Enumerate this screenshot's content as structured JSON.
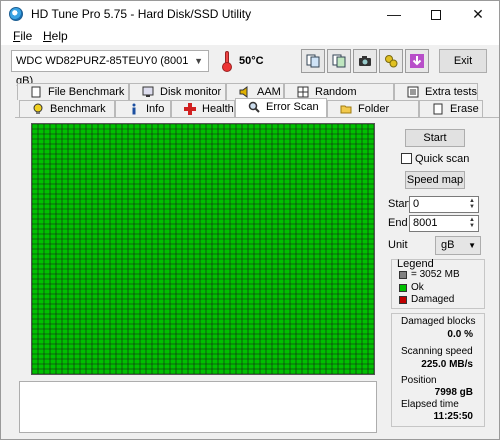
{
  "window": {
    "title": "HD Tune Pro 5.75 - Hard Disk/SSD Utility"
  },
  "menu": [
    {
      "label": "F",
      "rest": "ile"
    },
    {
      "label": "H",
      "rest": "elp"
    }
  ],
  "toolbar": {
    "drive": "WDC WD82PURZ-85TEUY0 (8001 gB)",
    "temperature": "50°C",
    "exit_label": "Exit"
  },
  "tabs": {
    "row1": [
      "File Benchmark",
      "Disk monitor",
      "AAM",
      "Random Access",
      "Extra tests"
    ],
    "row2": [
      "Benchmark",
      "Info",
      "Health",
      "Error Scan",
      "Folder Usage",
      "Erase"
    ],
    "active": "Error Scan"
  },
  "controls": {
    "start_button": "Start",
    "quick_scan_label": "Quick scan",
    "quick_scan_checked": false,
    "speed_map_button": "Speed map",
    "start_label": "Start",
    "start_value": "0",
    "end_label": "End",
    "end_value": "8001",
    "unit_label": "Unit",
    "unit_value": "gB"
  },
  "legend": {
    "title": "Legend",
    "items": [
      {
        "label": "= 3052 MB",
        "color": "#808080"
      },
      {
        "label": "Ok",
        "color": "#00c000"
      },
      {
        "label": "Damaged",
        "color": "#c00000"
      }
    ]
  },
  "stats": {
    "damaged_blocks_label": "Damaged blocks",
    "damaged_blocks_value": "0.0 %",
    "scanning_speed_label": "Scanning speed",
    "scanning_speed_value": "225.0 MB/s",
    "position_label": "Position",
    "position_value": "7998 gB",
    "elapsed_label": "Elapsed time",
    "elapsed_value": "11:25:50"
  },
  "colors": {
    "ok_block": "#00c000",
    "grid_line": "#1a1a1a"
  }
}
